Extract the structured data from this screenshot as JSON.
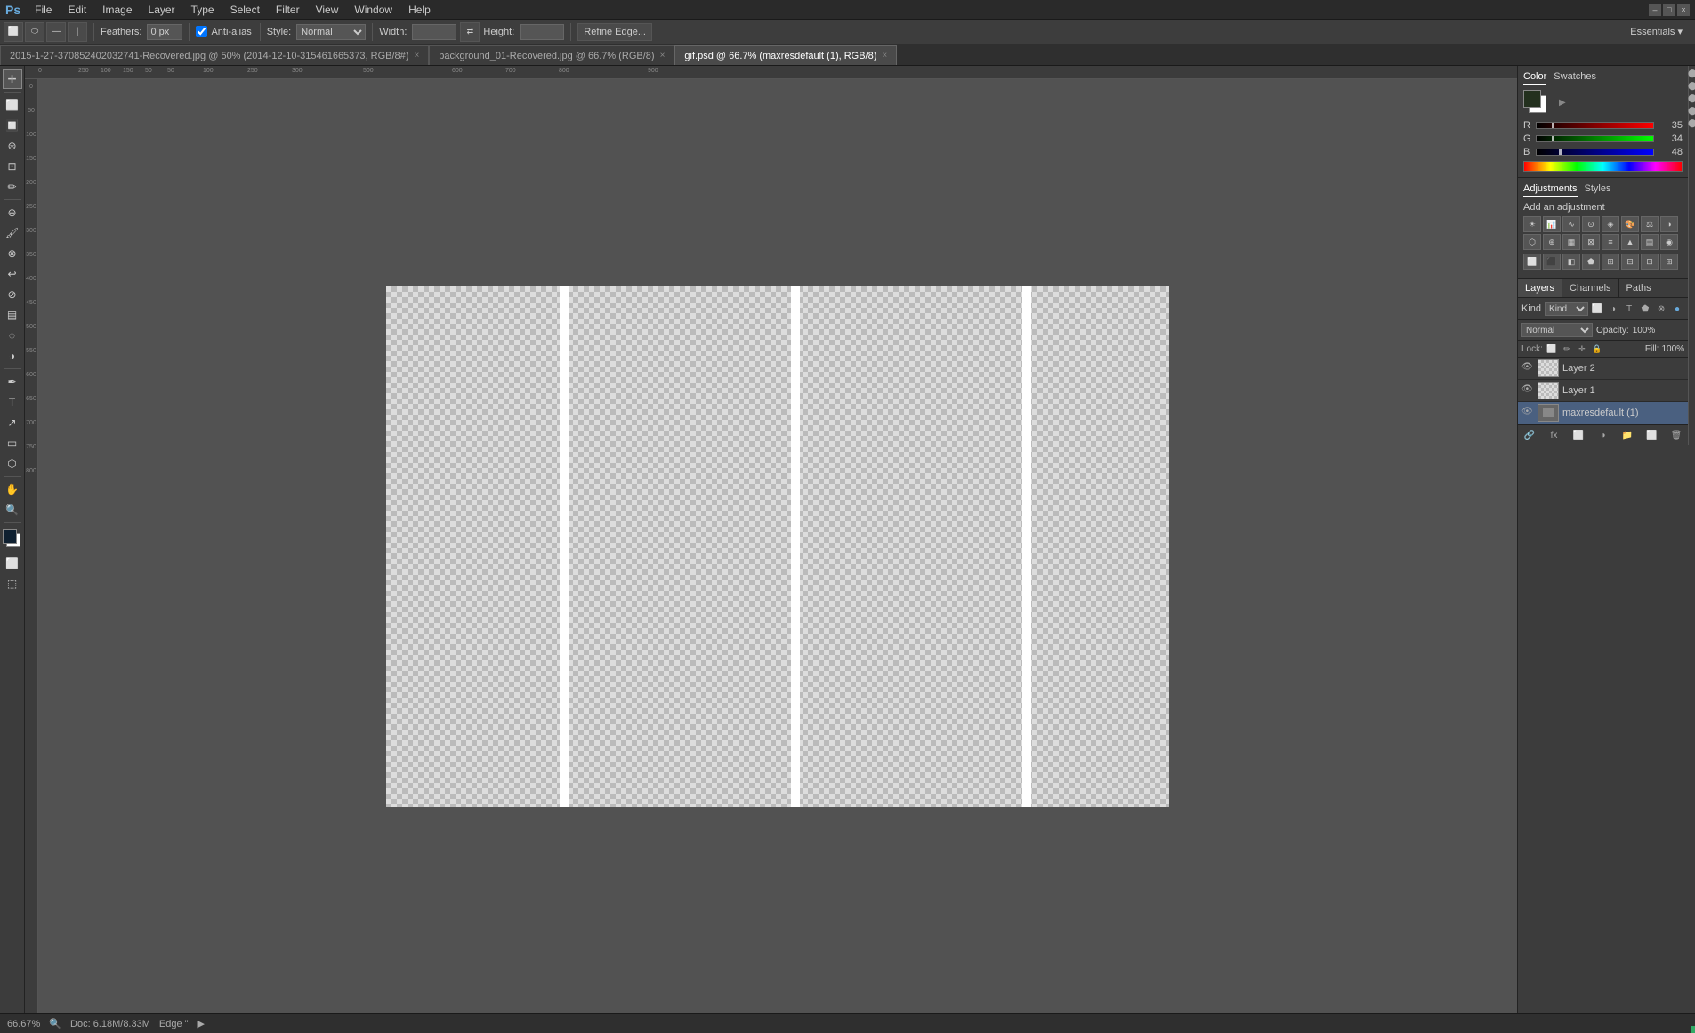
{
  "menuBar": {
    "items": [
      "File",
      "Edit",
      "Image",
      "Layer",
      "Type",
      "Select",
      "Filter",
      "View",
      "Window",
      "Help"
    ]
  },
  "windowControls": {
    "minimize": "–",
    "maximize": "□",
    "close": "×"
  },
  "toolbar": {
    "feathersLabel": "Feathers:",
    "feathersValue": "0 px",
    "antiAliasLabel": "Anti-alias",
    "styleLabel": "Style:",
    "styleValue": "Normal",
    "widthLabel": "Width:",
    "heightLabel": "Height:",
    "refineEdgeBtn": "Refine Edge...",
    "essentials": "Essentials ▾"
  },
  "tabs": [
    {
      "label": "2015-1-27-370852402032741-Recovered.jpg @ 50% (2014-12-10-315461665373, RGB/8#)",
      "active": false
    },
    {
      "label": "background_01-Recovered.jpg @ 66.7% (RGB/8)",
      "active": false
    },
    {
      "label": "gif.psd @ 66.7% (maxresdefault (1), RGB/8)",
      "active": true
    }
  ],
  "colorPanel": {
    "tabs": [
      "Color",
      "Swatches"
    ],
    "activeTab": "Color",
    "foregroundColor": "#23301e",
    "backgroundColor": "#ffffff",
    "rLabel": "R",
    "rValue": "35",
    "gLabel": "G",
    "gValue": "34",
    "bLabel": "B",
    "bValue": "48"
  },
  "adjustmentsPanel": {
    "tabs": [
      "Adjustments",
      "Styles"
    ],
    "activeTab": "Adjustments",
    "addAdjustmentLabel": "Add an adjustment"
  },
  "layersPanel": {
    "tabs": [
      "Layers",
      "Channels",
      "Paths"
    ],
    "activeTab": "Layers",
    "filterLabel": "Kind",
    "modeValue": "Normal",
    "opacityLabel": "Opacity:",
    "opacityValue": "100%",
    "lockLabel": "Lock:",
    "fillLabel": "Fill:",
    "fillValue": "100%",
    "layers": [
      {
        "name": "Layer 2",
        "visible": true,
        "selected": false,
        "hasChecker": true
      },
      {
        "name": "Layer 1",
        "visible": true,
        "selected": false,
        "hasChecker": true
      },
      {
        "name": "maxresdefault (1)",
        "visible": true,
        "selected": true,
        "hasChecker": false
      }
    ]
  },
  "statusBar": {
    "zoom": "66.67%",
    "docInfo": "Doc: 6.18M/8.33M",
    "edgeText": "Edge \""
  },
  "canvas": {
    "whiteStrip1Left": "195px",
    "whiteStrip2Left": "457px",
    "whiteStrip3Left": "718px"
  }
}
